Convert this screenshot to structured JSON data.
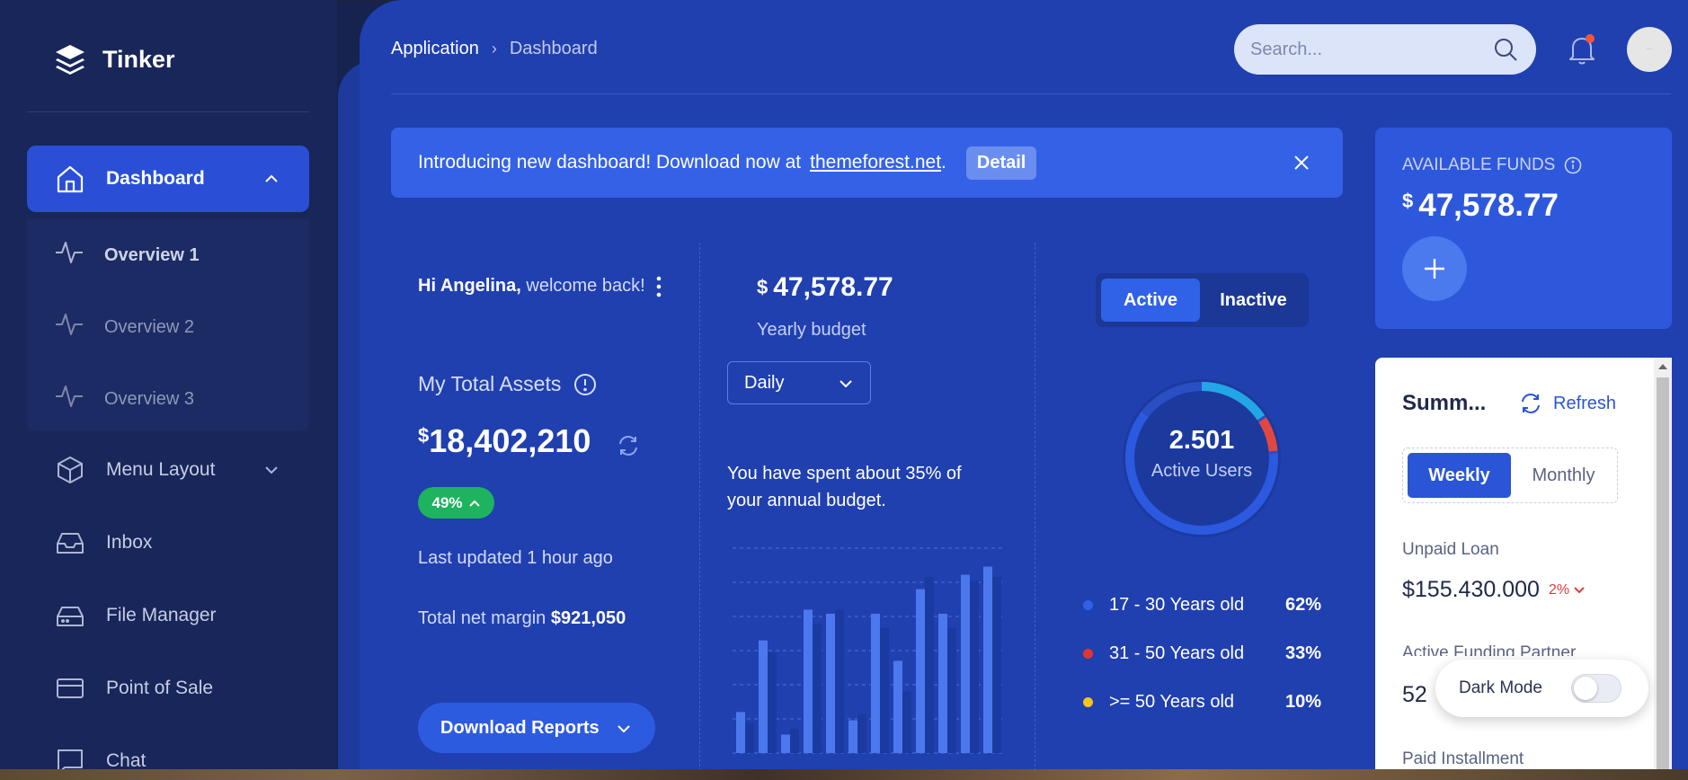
{
  "app": {
    "name": "Tinker"
  },
  "sidebar": {
    "items": [
      {
        "label": "Dashboard",
        "icon": "home-icon",
        "active": true
      },
      {
        "label": "Menu Layout",
        "icon": "cube-icon"
      },
      {
        "label": "Inbox",
        "icon": "inbox-icon"
      },
      {
        "label": "File Manager",
        "icon": "drive-icon"
      },
      {
        "label": "Point of Sale",
        "icon": "card-icon"
      },
      {
        "label": "Chat",
        "icon": "chat-icon"
      }
    ],
    "submenu": [
      {
        "label": "Overview 1",
        "current": true
      },
      {
        "label": "Overview 2"
      },
      {
        "label": "Overview 3"
      }
    ]
  },
  "header": {
    "breadcrumb": [
      "Application",
      "Dashboard"
    ],
    "search_placeholder": "Search...",
    "notification_badge_color": "#f2553a"
  },
  "banner": {
    "text": "Introducing new dashboard! Download now at",
    "link": "themeforest.net",
    "suffix": ".",
    "detail_label": "Detail"
  },
  "assets": {
    "greeting_name": "Hi Angelina,",
    "greeting_rest": " welcome back!",
    "title": "My Total Assets",
    "currency": "$",
    "value": "18,402,210",
    "change": "49%",
    "updated": "Last updated 1 hour ago",
    "margin_label": "Total net margin",
    "margin_value": "$921,050",
    "download_label": "Download Reports"
  },
  "budget": {
    "currency": "$",
    "value": "47,578.77",
    "label": "Yearly budget",
    "period": "Daily",
    "spent_text": "You have spent about 35% of your annual budget."
  },
  "chart_data": {
    "type": "bar",
    "categories": [
      "",
      "",
      "",
      "",
      "",
      "",
      "",
      "",
      "",
      "",
      "",
      ""
    ],
    "series": [
      {
        "values": [
          20,
          55,
          9,
          70,
          68,
          16,
          68,
          45,
          80,
          68,
          87,
          91
        ],
        "color": "#4c78ee"
      },
      {
        "values": [
          15,
          49,
          12,
          63,
          70,
          19,
          61,
          30,
          86,
          61,
          84,
          86
        ],
        "color": "#1a3aa0"
      }
    ],
    "ylim": [
      0,
      100
    ],
    "grid": true,
    "title": "",
    "xlabel": "",
    "ylabel": ""
  },
  "users": {
    "toggle": [
      "Active",
      "Inactive"
    ],
    "count": "2.501",
    "count_label": "Active Users",
    "ring_segments": [
      {
        "fraction": 0.62,
        "color": "#2b59e0"
      },
      {
        "fraction": 0.16,
        "color": "#22a6e8"
      },
      {
        "fraction": 0.08,
        "color": "#e2473f"
      }
    ],
    "legend": [
      {
        "label": "17 - 30 Years old",
        "value": "62%",
        "color": "#2f62e6"
      },
      {
        "label": "31 - 50 Years old",
        "value": "33%",
        "color": "#e2342f"
      },
      {
        "label": ">= 50 Years old",
        "value": "10%",
        "color": "#f5c518"
      }
    ]
  },
  "funds": {
    "label": "AVAILABLE FUNDS",
    "currency": "$",
    "value": "47,578.77"
  },
  "summary": {
    "title": "Summ...",
    "refresh_label": "Refresh",
    "periods": [
      "Weekly",
      "Monthly"
    ],
    "loan_label": "Unpaid Loan",
    "loan_value": "$155.430.000",
    "loan_change": "2%",
    "partner_label": "Active Funding Partner",
    "partner_value": "52",
    "installment_label": "Paid Installment"
  },
  "dark_mode": {
    "label": "Dark Mode",
    "enabled": false
  }
}
